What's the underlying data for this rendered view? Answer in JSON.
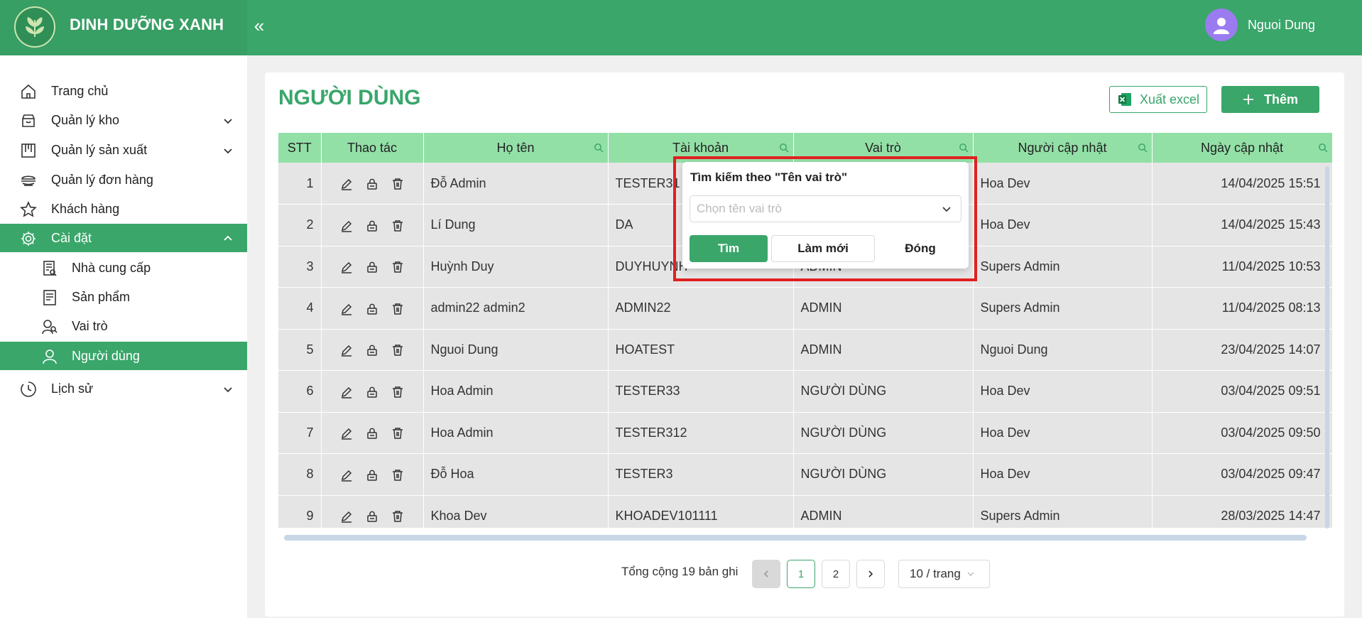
{
  "brand": {
    "name": "DINH DƯỠNG XANH",
    "collapse_icon": "«"
  },
  "user": {
    "name": "Nguoi Dung"
  },
  "sidebar": {
    "items": [
      {
        "label": "Trang chủ",
        "icon": "home-icon"
      },
      {
        "label": "Quản lý kho",
        "icon": "warehouse-icon",
        "expandable": true
      },
      {
        "label": "Quản lý sản xuất",
        "icon": "production-icon",
        "expandable": true
      },
      {
        "label": "Quản lý đơn hàng",
        "icon": "orders-icon"
      },
      {
        "label": "Khách hàng",
        "icon": "star-icon"
      },
      {
        "label": "Cài đặt",
        "icon": "gear-icon",
        "expandable": true,
        "expanded": true,
        "active": true
      },
      {
        "label": "Nhà cung cấp",
        "icon": "supplier-icon",
        "sub": true
      },
      {
        "label": "Sản phẩm",
        "icon": "product-icon",
        "sub": true
      },
      {
        "label": "Vai trò",
        "icon": "roles-icon",
        "sub": true
      },
      {
        "label": "Người dùng",
        "icon": "user-icon",
        "sub": true,
        "active": true
      },
      {
        "label": "Lịch sử",
        "icon": "history-icon",
        "expandable": true
      }
    ]
  },
  "page": {
    "title": "NGƯỜI DÙNG",
    "export_label": "Xuất excel",
    "add_label": "Thêm"
  },
  "table": {
    "columns": [
      "STT",
      "Thao tác",
      "Họ tên",
      "Tài khoản",
      "Vai trò",
      "Người cập nhật",
      "Ngày cập nhật"
    ],
    "rows": [
      {
        "stt": "1",
        "name": "Đỗ Admin",
        "account": "TESTER31",
        "role": "",
        "updater": "Hoa Dev",
        "date": "14/04/2025 15:51"
      },
      {
        "stt": "2",
        "name": "Lí Dung",
        "account": "DA",
        "role": "",
        "updater": "Hoa Dev",
        "date": "14/04/2025 15:43"
      },
      {
        "stt": "3",
        "name": "Huỳnh Duy",
        "account": "DUYHUYNH",
        "role": "ADMIN",
        "updater": "Supers Admin",
        "date": "11/04/2025 10:53"
      },
      {
        "stt": "4",
        "name": "admin22 admin2",
        "account": "ADMIN22",
        "role": "ADMIN",
        "updater": "Supers Admin",
        "date": "11/04/2025 08:13"
      },
      {
        "stt": "5",
        "name": "Nguoi Dung",
        "account": "HOATEST",
        "role": "ADMIN",
        "updater": "Nguoi Dung",
        "date": "23/04/2025 14:07"
      },
      {
        "stt": "6",
        "name": "Hoa Admin",
        "account": "TESTER33",
        "role": "NGƯỜI DÙNG",
        "updater": "Hoa Dev",
        "date": "03/04/2025 09:51"
      },
      {
        "stt": "7",
        "name": "Hoa Admin",
        "account": "TESTER312",
        "role": "NGƯỜI DÙNG",
        "updater": "Hoa Dev",
        "date": "03/04/2025 09:50"
      },
      {
        "stt": "8",
        "name": "Đỗ Hoa",
        "account": "TESTER3",
        "role": "NGƯỜI DÙNG",
        "updater": "Hoa Dev",
        "date": "03/04/2025 09:47"
      },
      {
        "stt": "9",
        "name": "Khoa Dev",
        "account": "KHOADEV101111",
        "role": "ADMIN",
        "updater": "Supers Admin",
        "date": "28/03/2025 14:47"
      }
    ]
  },
  "pagination": {
    "total_text": "Tổng cộng 19 bản ghi",
    "pages": [
      "1",
      "2"
    ],
    "current_page": "1",
    "page_size": "10 / trang"
  },
  "filter_popup": {
    "title": "Tìm kiếm theo \"Tên vai trò\"",
    "placeholder": "Chọn tên vai trò",
    "find_label": "Tìm",
    "reset_label": "Làm mới",
    "close_label": "Đóng"
  },
  "colors": {
    "primary": "#3aa66a",
    "header_row": "#93e0a7",
    "highlight": "#e02020"
  }
}
